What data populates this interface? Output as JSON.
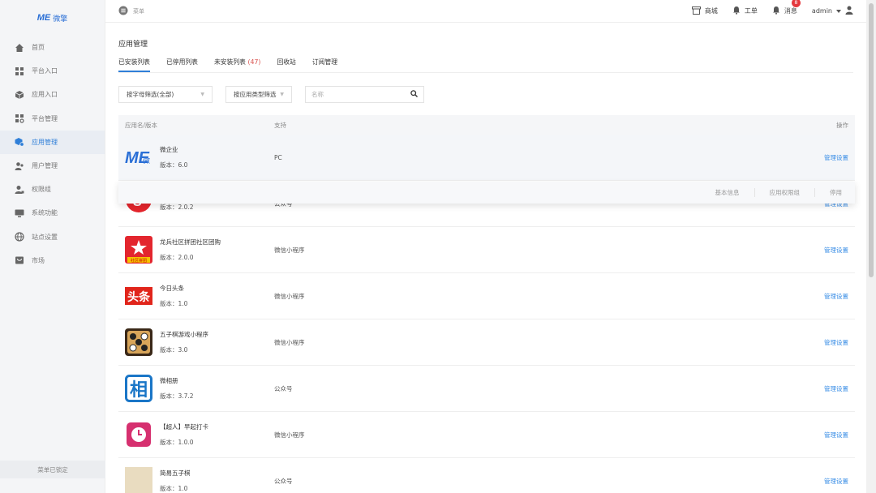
{
  "sidebar": {
    "logo_me": "ME",
    "logo_text": "微擎",
    "items": [
      {
        "label": "首页"
      },
      {
        "label": "平台入口"
      },
      {
        "label": "应用入口"
      },
      {
        "label": "平台管理"
      },
      {
        "label": "应用管理"
      },
      {
        "label": "用户管理"
      },
      {
        "label": "权限组"
      },
      {
        "label": "系统功能"
      },
      {
        "label": "站点设置"
      },
      {
        "label": "市场"
      }
    ],
    "lock_text": "菜单已锁定"
  },
  "topbar": {
    "menu_label": "菜单",
    "store": "商城",
    "workorder": "工单",
    "messages": "消息",
    "message_count": "8",
    "user": "admin"
  },
  "page": {
    "title": "应用管理",
    "tabs": [
      {
        "label": "已安装列表"
      },
      {
        "label": "已停用列表"
      },
      {
        "label": "未安装列表",
        "count": "(47)"
      },
      {
        "label": "回收站"
      },
      {
        "label": "订阅管理"
      }
    ],
    "filters": {
      "letter": "按字母筛选(全部)",
      "type": "按应用类型筛选",
      "search_placeholder": "名称"
    },
    "table": {
      "headers": {
        "name": "应用名/版本",
        "support": "支持",
        "op": "操作"
      },
      "rows": [
        {
          "name": "微企业",
          "version": "版本：6.0",
          "support": "PC",
          "action": "管理设置"
        },
        {
          "name": "",
          "version": "版本：2.0.2",
          "support": "公众号",
          "action": "管理设置"
        },
        {
          "name": "龙兵社区拼团社区团购",
          "version": "版本：2.0.0",
          "support": "微信小程序",
          "action": "管理设置"
        },
        {
          "name": "今日头条",
          "version": "版本：1.0",
          "support": "微信小程序",
          "action": "管理设置"
        },
        {
          "name": "五子棋游戏小程序",
          "version": "版本：3.0",
          "support": "微信小程序",
          "action": "管理设置"
        },
        {
          "name": "微相册",
          "version": "版本：3.7.2",
          "support": "公众号",
          "action": "管理设置"
        },
        {
          "name": "【超人】早起打卡",
          "version": "版本：1.0.0",
          "support": "微信小程序",
          "action": "管理设置"
        },
        {
          "name": "简易五子棋",
          "version": "版本：1.0",
          "support": "公众号",
          "action": "管理设置"
        }
      ],
      "popup": [
        "基本信息",
        "应用权限组",
        "停用"
      ]
    },
    "icons": {
      "row1_logo_text": "ME微擎",
      "row3_badge": "社区拼团",
      "row4_text": "头条",
      "row6_text": "相"
    }
  }
}
